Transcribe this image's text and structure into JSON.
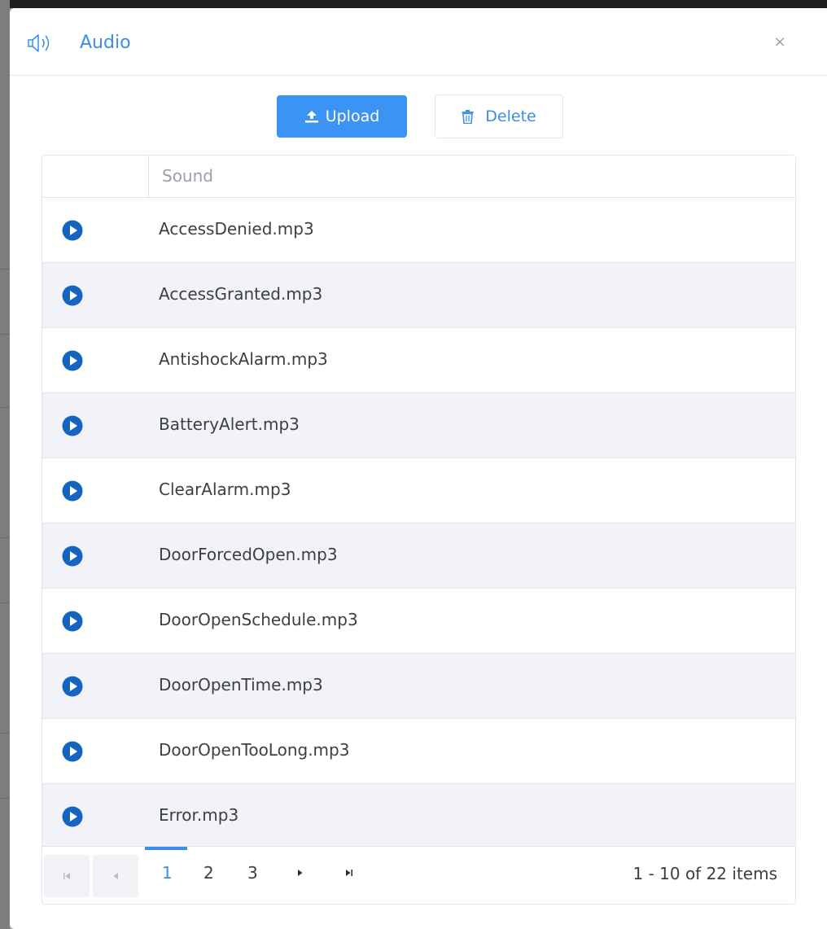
{
  "dialog": {
    "title": "Audio",
    "close_glyph": "×",
    "icon": "speaker-icon"
  },
  "toolbar": {
    "upload_label": "Upload",
    "delete_label": "Delete"
  },
  "grid": {
    "column_header": "Sound",
    "rows": [
      {
        "name": "AccessDenied.mp3"
      },
      {
        "name": "AccessGranted.mp3"
      },
      {
        "name": "AntishockAlarm.mp3"
      },
      {
        "name": "BatteryAlert.mp3"
      },
      {
        "name": "ClearAlarm.mp3"
      },
      {
        "name": "DoorForcedOpen.mp3"
      },
      {
        "name": "DoorOpenSchedule.mp3"
      },
      {
        "name": "DoorOpenTime.mp3"
      },
      {
        "name": "DoorOpenTooLong.mp3"
      },
      {
        "name": "Error.mp3"
      }
    ]
  },
  "pager": {
    "pages": [
      "1",
      "2",
      "3"
    ],
    "current_page": "1",
    "info": "1 - 10 of 22 items"
  },
  "colors": {
    "accent": "#3b8ee8",
    "play_icon": "#1565c0",
    "row_alt": "#f2f3f8"
  }
}
